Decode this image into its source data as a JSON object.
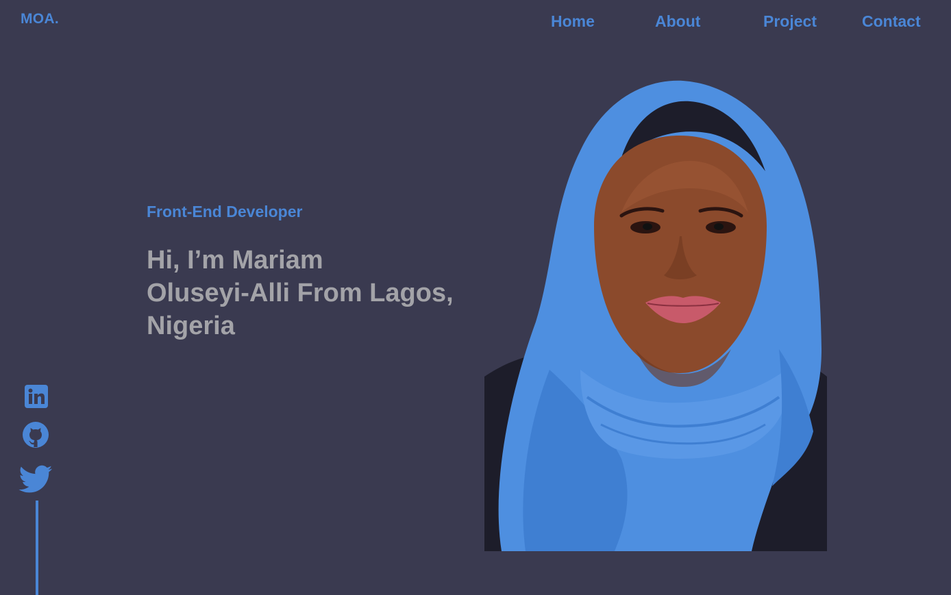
{
  "header": {
    "logo": "MOA.",
    "nav": [
      {
        "label": "Home"
      },
      {
        "label": "About"
      },
      {
        "label": "Project"
      },
      {
        "label": "Contact"
      }
    ]
  },
  "hero": {
    "role": "Front-End Developer",
    "heading_line1": "Hi, I’m Mariam",
    "heading_line2": "Oluseyi-Alli From Lagos,",
    "heading_line3": "Nigeria"
  },
  "social": [
    {
      "icon": "linkedin-icon"
    },
    {
      "icon": "github-icon"
    },
    {
      "icon": "twitter-icon"
    }
  ],
  "colors": {
    "background": "#3a3a50",
    "accent": "#4a86d6",
    "heading_text": "#a3a3a8"
  }
}
